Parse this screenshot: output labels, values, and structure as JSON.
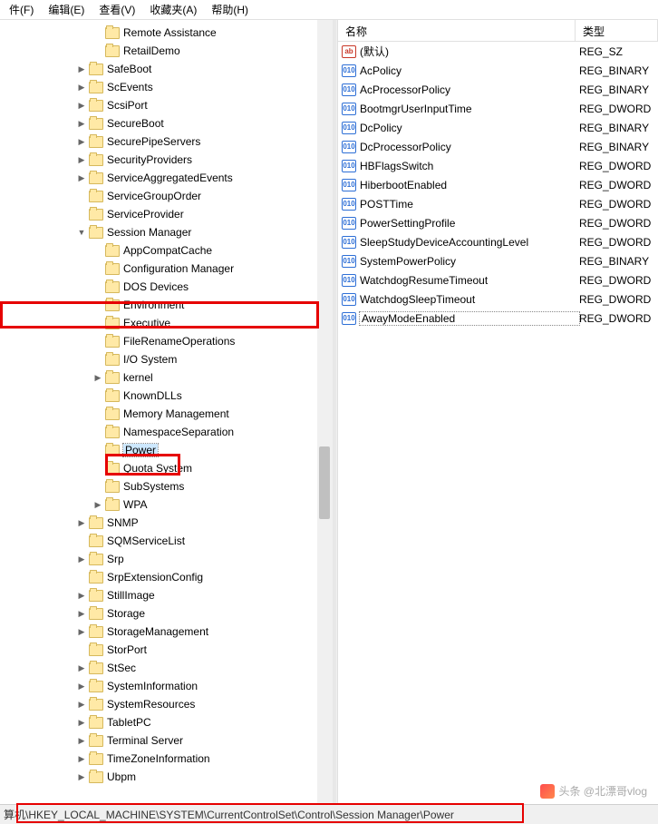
{
  "menu": {
    "file": "件(F)",
    "edit": "编辑(E)",
    "view": "查看(V)",
    "fav": "收藏夹(A)",
    "help": "帮助(H)"
  },
  "tree": [
    {
      "indent": 4,
      "exp": " ",
      "label": "Remote Assistance"
    },
    {
      "indent": 4,
      "exp": " ",
      "label": "RetailDemo"
    },
    {
      "indent": 3,
      "exp": ">",
      "label": "SafeBoot"
    },
    {
      "indent": 3,
      "exp": ">",
      "label": "ScEvents"
    },
    {
      "indent": 3,
      "exp": ">",
      "label": "ScsiPort"
    },
    {
      "indent": 3,
      "exp": ">",
      "label": "SecureBoot"
    },
    {
      "indent": 3,
      "exp": ">",
      "label": "SecurePipeServers"
    },
    {
      "indent": 3,
      "exp": ">",
      "label": "SecurityProviders"
    },
    {
      "indent": 3,
      "exp": ">",
      "label": "ServiceAggregatedEvents"
    },
    {
      "indent": 3,
      "exp": " ",
      "label": "ServiceGroupOrder"
    },
    {
      "indent": 3,
      "exp": " ",
      "label": "ServiceProvider"
    },
    {
      "indent": 3,
      "exp": "v",
      "label": "Session Manager"
    },
    {
      "indent": 4,
      "exp": " ",
      "label": "AppCompatCache"
    },
    {
      "indent": 4,
      "exp": " ",
      "label": "Configuration Manager"
    },
    {
      "indent": 4,
      "exp": " ",
      "label": "DOS Devices"
    },
    {
      "indent": 4,
      "exp": " ",
      "label": "Environment"
    },
    {
      "indent": 4,
      "exp": " ",
      "label": "Executive"
    },
    {
      "indent": 4,
      "exp": " ",
      "label": "FileRenameOperations"
    },
    {
      "indent": 4,
      "exp": " ",
      "label": "I/O System"
    },
    {
      "indent": 4,
      "exp": ">",
      "label": "kernel"
    },
    {
      "indent": 4,
      "exp": " ",
      "label": "KnownDLLs"
    },
    {
      "indent": 4,
      "exp": " ",
      "label": "Memory Management"
    },
    {
      "indent": 4,
      "exp": " ",
      "label": "NamespaceSeparation"
    },
    {
      "indent": 4,
      "exp": " ",
      "label": "Power",
      "selected": true
    },
    {
      "indent": 4,
      "exp": " ",
      "label": "Quota System"
    },
    {
      "indent": 4,
      "exp": " ",
      "label": "SubSystems"
    },
    {
      "indent": 4,
      "exp": ">",
      "label": "WPA"
    },
    {
      "indent": 3,
      "exp": ">",
      "label": "SNMP"
    },
    {
      "indent": 3,
      "exp": " ",
      "label": "SQMServiceList"
    },
    {
      "indent": 3,
      "exp": ">",
      "label": "Srp"
    },
    {
      "indent": 3,
      "exp": " ",
      "label": "SrpExtensionConfig"
    },
    {
      "indent": 3,
      "exp": ">",
      "label": "StillImage"
    },
    {
      "indent": 3,
      "exp": ">",
      "label": "Storage"
    },
    {
      "indent": 3,
      "exp": ">",
      "label": "StorageManagement"
    },
    {
      "indent": 3,
      "exp": " ",
      "label": "StorPort"
    },
    {
      "indent": 3,
      "exp": ">",
      "label": "StSec"
    },
    {
      "indent": 3,
      "exp": ">",
      "label": "SystemInformation"
    },
    {
      "indent": 3,
      "exp": ">",
      "label": "SystemResources"
    },
    {
      "indent": 3,
      "exp": ">",
      "label": "TabletPC"
    },
    {
      "indent": 3,
      "exp": ">",
      "label": "Terminal Server"
    },
    {
      "indent": 3,
      "exp": ">",
      "label": "TimeZoneInformation"
    },
    {
      "indent": 3,
      "exp": ">",
      "label": "Ubpm"
    }
  ],
  "cols": {
    "name": "名称",
    "type": "类型"
  },
  "values": [
    {
      "icon": "str",
      "name": "(默认)",
      "type": "REG_SZ"
    },
    {
      "icon": "bin",
      "name": "AcPolicy",
      "type": "REG_BINARY"
    },
    {
      "icon": "bin",
      "name": "AcProcessorPolicy",
      "type": "REG_BINARY"
    },
    {
      "icon": "bin",
      "name": "BootmgrUserInputTime",
      "type": "REG_DWORD"
    },
    {
      "icon": "bin",
      "name": "DcPolicy",
      "type": "REG_BINARY"
    },
    {
      "icon": "bin",
      "name": "DcProcessorPolicy",
      "type": "REG_BINARY"
    },
    {
      "icon": "bin",
      "name": "HBFlagsSwitch",
      "type": "REG_DWORD"
    },
    {
      "icon": "bin",
      "name": "HiberbootEnabled",
      "type": "REG_DWORD"
    },
    {
      "icon": "bin",
      "name": "POSTTime",
      "type": "REG_DWORD"
    },
    {
      "icon": "bin",
      "name": "PowerSettingProfile",
      "type": "REG_DWORD"
    },
    {
      "icon": "bin",
      "name": "SleepStudyDeviceAccountingLevel",
      "type": "REG_DWORD"
    },
    {
      "icon": "bin",
      "name": "SystemPowerPolicy",
      "type": "REG_BINARY"
    },
    {
      "icon": "bin",
      "name": "WatchdogResumeTimeout",
      "type": "REG_DWORD"
    },
    {
      "icon": "bin",
      "name": "WatchdogSleepTimeout",
      "type": "REG_DWORD"
    },
    {
      "icon": "bin",
      "name": "AwayModeEnabled",
      "type": "REG_DWORD",
      "editing": true
    }
  ],
  "status": {
    "label": "算机",
    "path": "\\HKEY_LOCAL_MACHINE\\SYSTEM\\CurrentControlSet\\Control\\Session Manager\\Power"
  },
  "watermark": "头条 @北漂哥vlog",
  "icon_text": {
    "str": "ab",
    "bin": "011\n110"
  }
}
